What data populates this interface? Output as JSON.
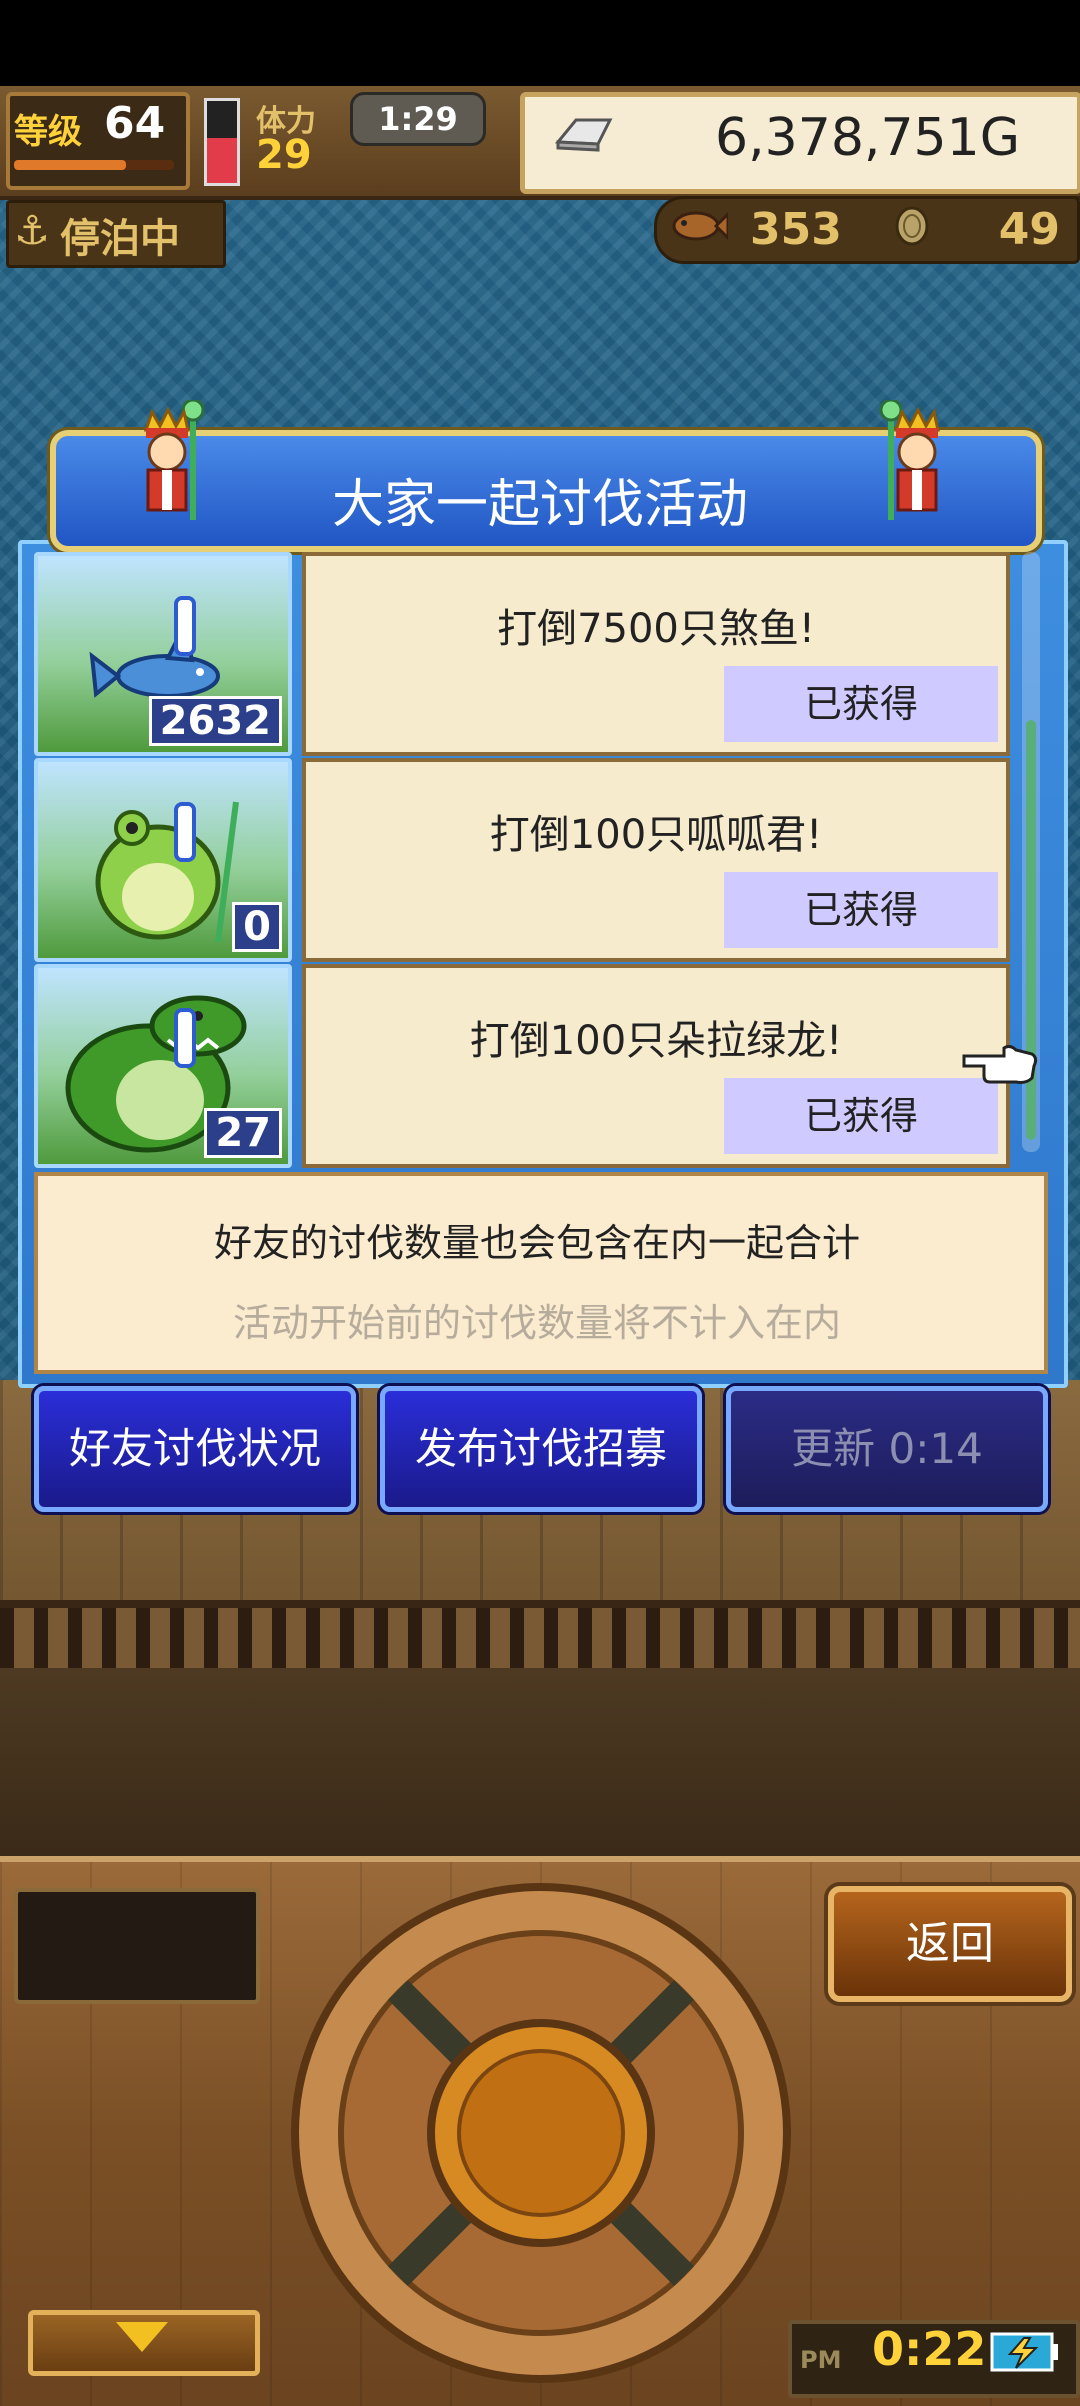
{
  "hud": {
    "level_label": "等级",
    "level": "64",
    "level_progress": 0.7,
    "stamina_label": "体力",
    "stamina": "29",
    "stamina_fill": 0.55,
    "timer": "1:29",
    "gold": "6,378,751G",
    "anchor_label": "停泊中",
    "fish_count": "353",
    "coin_count": "49"
  },
  "dialog": {
    "title": "大家一起讨伐活动",
    "rows": [
      {
        "title": "打倒7500只煞鱼!",
        "badge": "已获得",
        "count": "2632",
        "monster_icon": "shark-monster-icon"
      },
      {
        "title": "打倒100只呱呱君!",
        "badge": "已获得",
        "count": "0",
        "monster_icon": "frog-monster-icon"
      },
      {
        "title": "打倒100只朵拉绿龙!",
        "badge": "已获得",
        "count": "27",
        "monster_icon": "green-dragon-icon"
      }
    ],
    "info_line1": "好友的讨伐数量也会包含在内一起合计",
    "info_line2": "活动开始前的讨伐数量将不计入在内",
    "buttons": {
      "friend_status": "好友讨伐状况",
      "post_recruit": "发布讨伐招募",
      "update": "更新 0:14"
    }
  },
  "controls": {
    "back": "返回",
    "clock_ampm": "PM",
    "clock_time": "0:22"
  },
  "colors": {
    "dialog_blue": "#2f78cc",
    "card_cream": "#f6ebcd",
    "badge_lavender": "#cfcaff",
    "button_blue": "#2a2ed8",
    "gold_text": "#ffd23a"
  }
}
